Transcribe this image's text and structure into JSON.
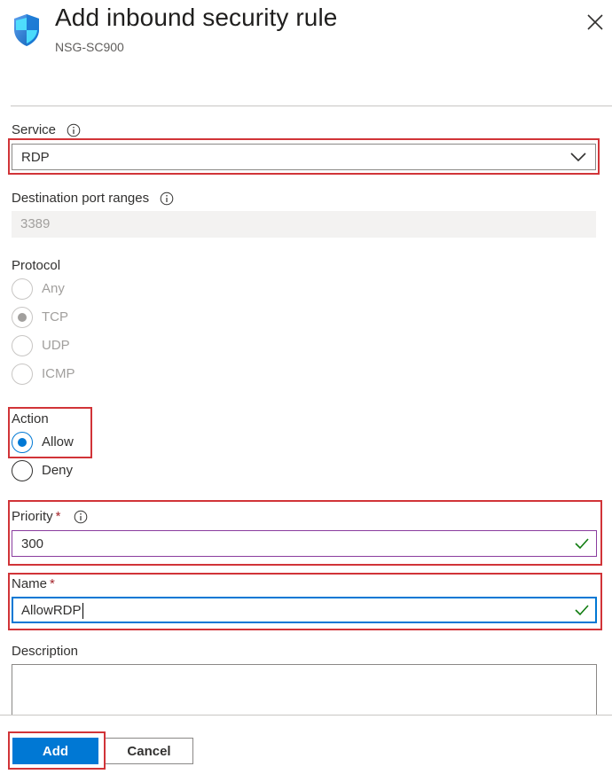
{
  "header": {
    "title": "Add inbound security rule",
    "subtitle": "NSG-SC900"
  },
  "service": {
    "label": "Service",
    "value": "RDP"
  },
  "destination_port_ranges": {
    "label": "Destination port ranges",
    "value": "3389"
  },
  "protocol": {
    "label": "Protocol",
    "options": [
      "Any",
      "TCP",
      "UDP",
      "ICMP"
    ],
    "selected": "TCP"
  },
  "action": {
    "label": "Action",
    "options": [
      "Allow",
      "Deny"
    ],
    "selected": "Allow"
  },
  "priority": {
    "label": "Priority",
    "required_mark": "*",
    "value": "300"
  },
  "name": {
    "label": "Name",
    "required_mark": "*",
    "value": "AllowRDP"
  },
  "description": {
    "label": "Description",
    "value": ""
  },
  "footer": {
    "add_label": "Add",
    "cancel_label": "Cancel"
  },
  "colors": {
    "accent": "#0078d4",
    "highlight": "#d13438",
    "success": "#107c10",
    "required": "#a4262c"
  },
  "icons": {
    "header": "shield-icon",
    "close": "close-icon",
    "info": "info-icon",
    "dropdown": "chevron-down-icon",
    "valid": "checkmark-icon"
  }
}
